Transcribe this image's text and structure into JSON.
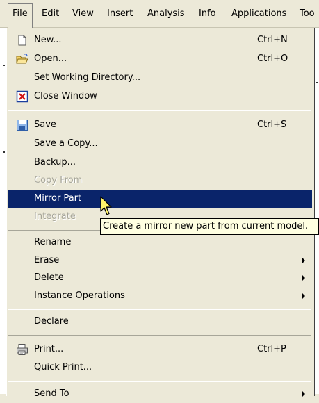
{
  "menubar": {
    "items": [
      "File",
      "Edit",
      "View",
      "Insert",
      "Analysis",
      "Info",
      "Applications",
      "Too"
    ]
  },
  "file_menu": {
    "new": {
      "label": "New...",
      "shortcut": "Ctrl+N",
      "icon": "new-document-icon"
    },
    "open": {
      "label": "Open...",
      "shortcut": "Ctrl+O",
      "icon": "open-folder-icon"
    },
    "set_working_directory": {
      "label": "Set Working Directory..."
    },
    "close_window": {
      "label": "Close Window",
      "icon": "close-window-icon"
    },
    "save": {
      "label": "Save",
      "shortcut": "Ctrl+S",
      "icon": "save-disk-icon"
    },
    "save_a_copy": {
      "label": "Save a Copy..."
    },
    "backup": {
      "label": "Backup..."
    },
    "copy_from": {
      "label": "Copy From",
      "disabled": true
    },
    "mirror_part": {
      "label": "Mirror Part",
      "highlighted": true
    },
    "integrate": {
      "label": "Integrate",
      "disabled": true
    },
    "rename": {
      "label": "Rename"
    },
    "erase": {
      "label": "Erase",
      "submenu": true
    },
    "delete": {
      "label": "Delete",
      "submenu": true
    },
    "instance_operations": {
      "label": "Instance Operations",
      "submenu": true
    },
    "declare": {
      "label": "Declare"
    },
    "print": {
      "label": "Print...",
      "shortcut": "Ctrl+P",
      "icon": "printer-icon"
    },
    "quick_print": {
      "label": "Quick Print..."
    },
    "send_to": {
      "label": "Send To",
      "submenu": true
    }
  },
  "tooltip": {
    "text": "Create a mirror new part from current model."
  },
  "colors": {
    "highlight": "#0a246a",
    "menu_bg": "#ece9d8",
    "tooltip_bg": "#ffffe1",
    "disabled_text": "#a7a699"
  }
}
